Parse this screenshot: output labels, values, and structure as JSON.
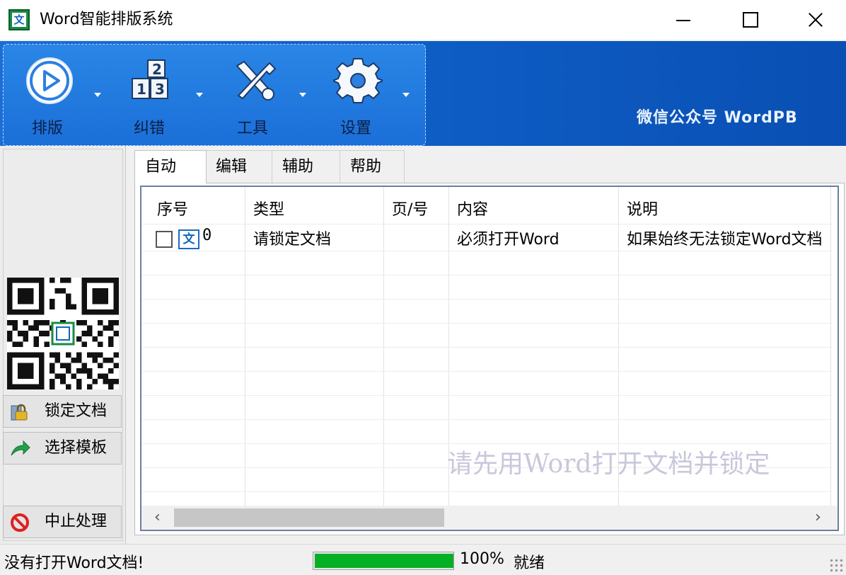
{
  "window": {
    "title": "Word智能排版系统"
  },
  "toolbar": {
    "buttons": [
      {
        "label": "排版",
        "icon": "play-icon"
      },
      {
        "label": "纠错",
        "icon": "number-blocks-icon"
      },
      {
        "label": "工具",
        "icon": "tools-icon"
      },
      {
        "label": "设置",
        "icon": "gear-icon"
      }
    ],
    "wechat": "微信公众号  WordPB"
  },
  "sidebar": {
    "lock_label": "锁定文档",
    "template_label": "选择模板",
    "stop_label": "中止处理"
  },
  "tabs": [
    "自动",
    "编辑",
    "辅助",
    "帮助"
  ],
  "table": {
    "headers": [
      "序号",
      "类型",
      "页/号",
      "内容",
      "说明"
    ],
    "rows": [
      {
        "no": "0",
        "type": "请锁定文档",
        "page": "",
        "content": "必须打开Word",
        "note": "如果始终无法锁定Word文档"
      }
    ],
    "watermark": "请先用Word打开文档并锁定",
    "row_icon_glyph": "文"
  },
  "status": {
    "message": "没有打开Word文档!",
    "progress_percent": 100,
    "progress_text": "100%",
    "state": "就绪"
  },
  "colors": {
    "ribbon": "#1b6ed6",
    "progress": "#06b025",
    "app_icon": "#1a8a44"
  }
}
